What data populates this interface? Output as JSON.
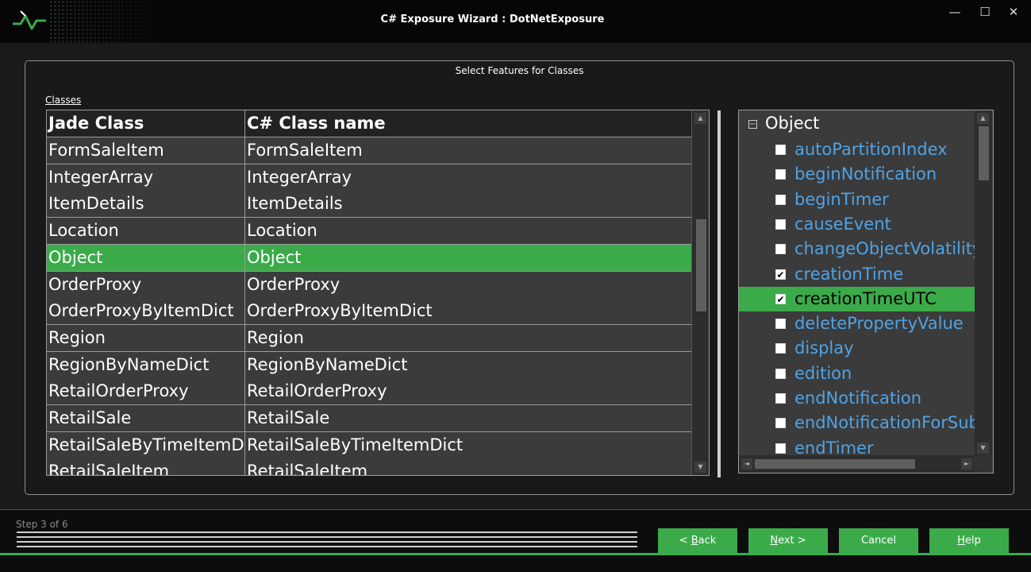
{
  "window": {
    "title": "C# Exposure Wizard : DotNetExposure",
    "minimize_icon": "minimize-icon",
    "maximize_icon": "maximize-icon",
    "close_icon": "close-icon"
  },
  "panel": {
    "title": "Select Features for Classes",
    "classes_label": "Classes"
  },
  "table": {
    "columns": [
      "Jade Class",
      "C# Class name"
    ],
    "rows": [
      {
        "jade": "FormSaleItem",
        "csharp": "FormSaleItem",
        "selected": false
      },
      {
        "jade": "IntegerArray",
        "csharp": "IntegerArray",
        "selected": false
      },
      {
        "jade": "ItemDetails",
        "csharp": "ItemDetails",
        "selected": false
      },
      {
        "jade": "Location",
        "csharp": "Location",
        "selected": false
      },
      {
        "jade": "Object",
        "csharp": "Object",
        "selected": true
      },
      {
        "jade": "OrderProxy",
        "csharp": "OrderProxy",
        "selected": false
      },
      {
        "jade": "OrderProxyByItemDict",
        "csharp": "OrderProxyByItemDict",
        "selected": false
      },
      {
        "jade": "Region",
        "csharp": "Region",
        "selected": false
      },
      {
        "jade": "RegionByNameDict",
        "csharp": "RegionByNameDict",
        "selected": false
      },
      {
        "jade": "RetailOrderProxy",
        "csharp": "RetailOrderProxy",
        "selected": false
      },
      {
        "jade": "RetailSale",
        "csharp": "RetailSale",
        "selected": false
      },
      {
        "jade": "RetailSaleByTimeItemDi",
        "csharp": "RetailSaleByTimeItemDict",
        "selected": false
      },
      {
        "jade": "RetailSaleItem",
        "csharp": "RetailSaleItem",
        "selected": false
      }
    ]
  },
  "tree": {
    "root": "Object",
    "items": [
      {
        "label": "autoPartitionIndex",
        "checked": false,
        "selected": false
      },
      {
        "label": "beginNotification",
        "checked": false,
        "selected": false
      },
      {
        "label": "beginTimer",
        "checked": false,
        "selected": false
      },
      {
        "label": "causeEvent",
        "checked": false,
        "selected": false
      },
      {
        "label": "changeObjectVolatility",
        "checked": false,
        "selected": false
      },
      {
        "label": "creationTime",
        "checked": true,
        "selected": false
      },
      {
        "label": "creationTimeUTC",
        "checked": true,
        "selected": true
      },
      {
        "label": "deletePropertyValue",
        "checked": false,
        "selected": false
      },
      {
        "label": "display",
        "checked": false,
        "selected": false
      },
      {
        "label": "edition",
        "checked": false,
        "selected": false
      },
      {
        "label": "endNotification",
        "checked": false,
        "selected": false
      },
      {
        "label": "endNotificationForSubscriber",
        "checked": false,
        "selected": false
      },
      {
        "label": "endTimer",
        "checked": false,
        "selected": false
      }
    ]
  },
  "footer": {
    "step": "Step 3 of 6",
    "buttons": {
      "back_prefix": "< ",
      "back_key": "B",
      "back_rest": "ack",
      "next_key": "N",
      "next_rest": "ext >",
      "cancel": "Cancel",
      "help_key": "H",
      "help_rest": "elp"
    }
  },
  "colors": {
    "accent": "#3bab4a",
    "tree_link": "#4fa3e6",
    "background": "#191919"
  }
}
